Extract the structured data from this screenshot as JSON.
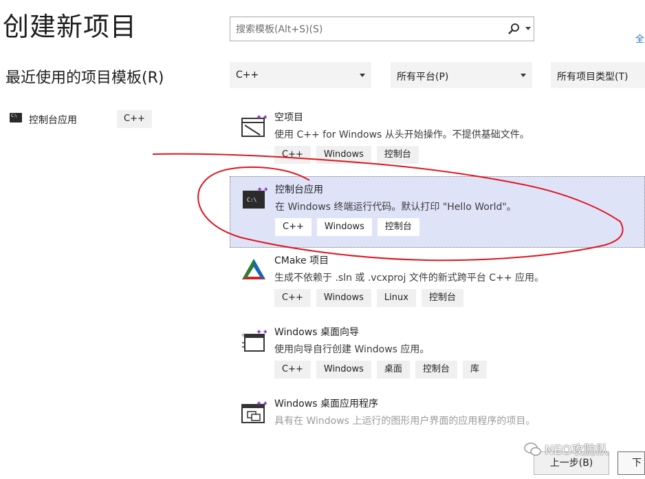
{
  "header": {
    "title": "创建新项目",
    "clear_all": "全"
  },
  "search": {
    "placeholder": "搜索模板(Alt+S)(S)",
    "icon": "search-icon"
  },
  "recent": {
    "title": "最近使用的项目模板(R)",
    "items": [
      {
        "name": "控制台应用",
        "language": "C++",
        "icon": "console-app-icon"
      }
    ]
  },
  "filters": {
    "language": "C++",
    "platform": "所有平台(P)",
    "project_type": "所有项目类型(T)"
  },
  "templates": [
    {
      "name": "空项目",
      "description": "使用 C++ for Windows 从头开始操作。不提供基础文件。",
      "tags": [
        "C++",
        "Windows",
        "控制台"
      ],
      "icon": "empty-project-icon",
      "selected": false
    },
    {
      "name": "控制台应用",
      "description": "在 Windows 终端运行代码。默认打印 \"Hello World\"。",
      "tags": [
        "C++",
        "Windows",
        "控制台"
      ],
      "icon": "console-app-icon",
      "selected": true
    },
    {
      "name": "CMake 项目",
      "description": "生成不依赖于 .sln 或 .vcxproj 文件的新式跨平台 C++ 应用。",
      "tags": [
        "C++",
        "Windows",
        "Linux",
        "控制台"
      ],
      "icon": "cmake-icon",
      "selected": false
    },
    {
      "name": "Windows 桌面向导",
      "description": "使用向导自行创建 Windows 应用。",
      "tags": [
        "C++",
        "Windows",
        "桌面",
        "控制台",
        "库"
      ],
      "icon": "desktop-wizard-icon",
      "selected": false
    },
    {
      "name": "Windows 桌面应用程序",
      "description": "具有在 Windows 上运行的图形用户界面的应用程序的项目。",
      "tags": [],
      "icon": "desktop-app-icon",
      "selected": false
    }
  ],
  "footer": {
    "back_label": "上一步(B)",
    "next_label": "下一"
  },
  "watermark": "NEO攻防队",
  "colors": {
    "selected_bg": "#dfe3f8",
    "annotation_red": "#e0141c",
    "link_blue": "#1a73c9"
  }
}
